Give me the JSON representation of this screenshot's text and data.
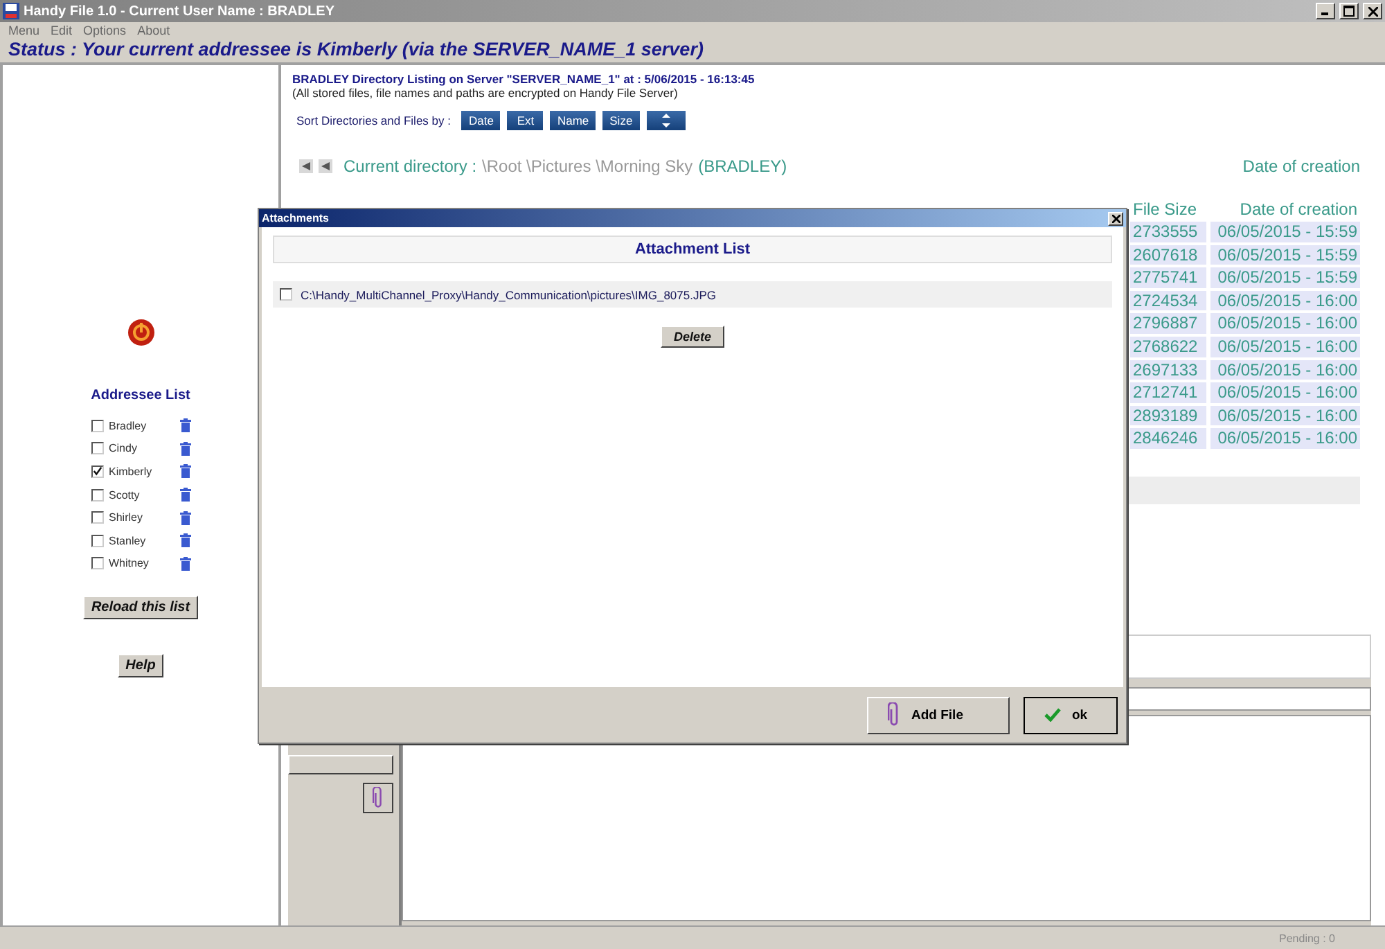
{
  "window": {
    "title": "Handy File 1.0 - Current User Name : BRADLEY"
  },
  "menu": [
    "Menu",
    "Edit",
    "Options",
    "About"
  ],
  "status": "Status : Your current addressee is Kimberly (via the SERVER_NAME_1 server)",
  "addressees": {
    "title": "Addressee List",
    "items": [
      {
        "name": "Bradley",
        "checked": false
      },
      {
        "name": "Cindy",
        "checked": false
      },
      {
        "name": "Kimberly",
        "checked": true
      },
      {
        "name": "Scotty",
        "checked": false
      },
      {
        "name": "Shirley",
        "checked": false
      },
      {
        "name": "Stanley",
        "checked": false
      },
      {
        "name": "Whitney",
        "checked": false
      }
    ],
    "reload_button": "Reload this list",
    "help_button": "Help"
  },
  "listing": {
    "heading": "BRADLEY Directory Listing on Server \"SERVER_NAME_1\" at : 5/06/2015 - 16:13:45",
    "note": "(All stored files, file names and paths are encrypted on Handy File Server)",
    "sort_label": "Sort Directories and Files by :",
    "sort_buttons": [
      "Date",
      "Ext",
      "Name",
      "Size"
    ],
    "current_dir_label": "Current directory :",
    "current_dir_path": "\\Root \\Pictures \\Morning Sky",
    "current_dir_owner": "(BRADLEY)",
    "date_header": "Date of creation",
    "table": {
      "columns": [
        "File Size",
        "Date of creation"
      ],
      "rows": [
        [
          "2733555",
          "06/05/2015 - 15:59"
        ],
        [
          "2607618",
          "06/05/2015 - 15:59"
        ],
        [
          "2775741",
          "06/05/2015 - 15:59"
        ],
        [
          "2724534",
          "06/05/2015 - 16:00"
        ],
        [
          "2796887",
          "06/05/2015 - 16:00"
        ],
        [
          "2768622",
          "06/05/2015 - 16:00"
        ],
        [
          "2697133",
          "06/05/2015 - 16:00"
        ],
        [
          "2712741",
          "06/05/2015 - 16:00"
        ],
        [
          "2893189",
          "06/05/2015 - 16:00"
        ],
        [
          "2846246",
          "06/05/2015 - 16:00"
        ]
      ]
    }
  },
  "dialog": {
    "title": "Attachments",
    "list_title": "Attachment List",
    "files": [
      {
        "path": "C:\\Handy_MultiChannel_Proxy\\Handy_Communication\\pictures\\IMG_8075.JPG",
        "checked": false
      }
    ],
    "delete_button": "Delete",
    "add_file_button": "Add File",
    "ok_button": "ok"
  },
  "status_bar": "Pending : 0"
}
